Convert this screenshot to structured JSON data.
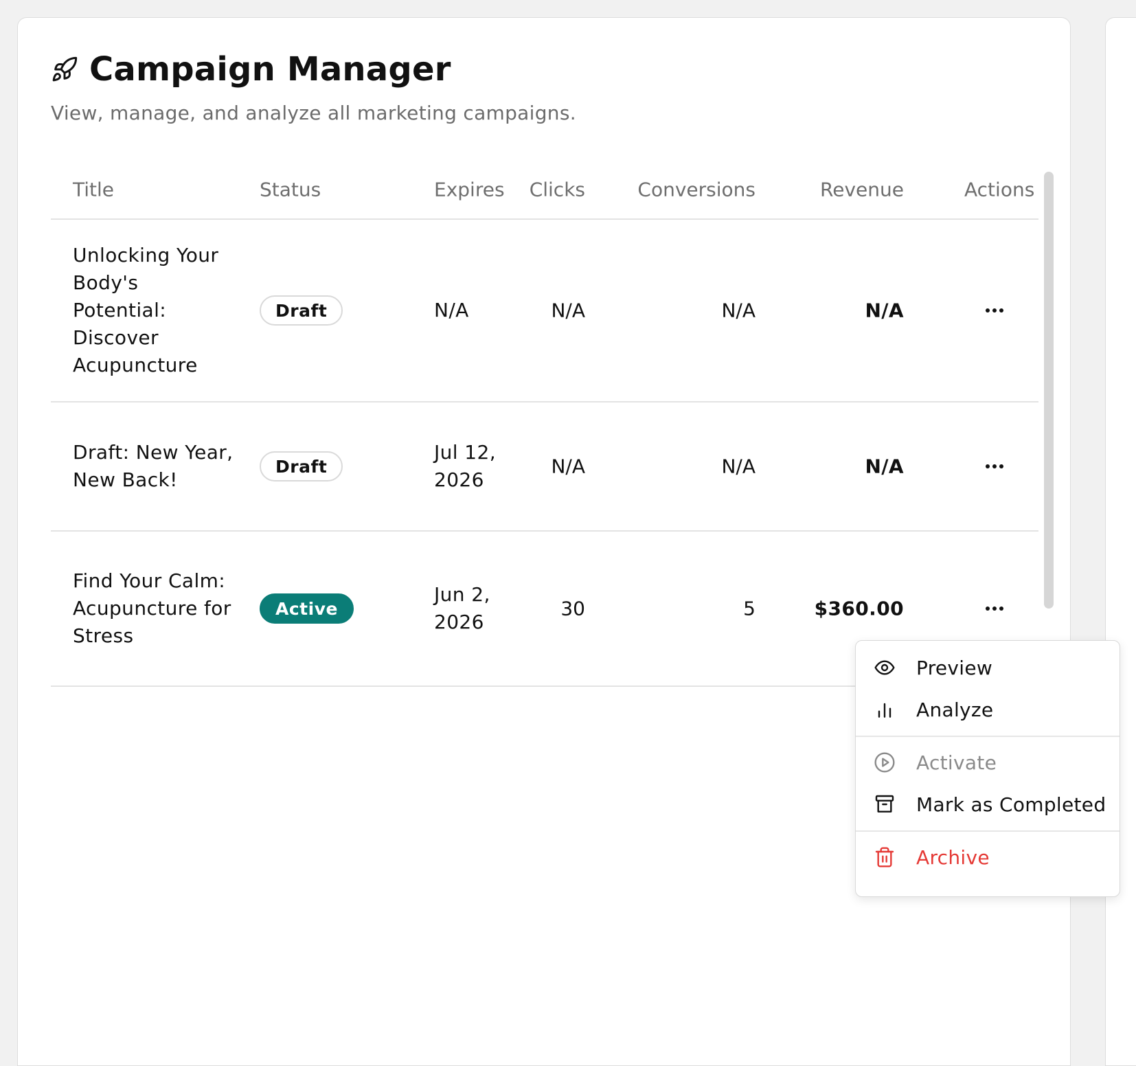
{
  "header": {
    "title": "Campaign Manager",
    "subtitle": "View, manage, and analyze all marketing campaigns.",
    "icon": "rocket-icon"
  },
  "table": {
    "columns": [
      "Title",
      "Status",
      "Expires",
      "Clicks",
      "Conversions",
      "Revenue",
      "Actions"
    ],
    "rows": [
      {
        "title": "Unlocking Your Body's Potential: Discover Acupuncture",
        "status": "Draft",
        "expires": "N/A",
        "clicks": "N/A",
        "conversions": "N/A",
        "revenue": "N/A"
      },
      {
        "title": "Draft: New Year, New Back!",
        "status": "Draft",
        "expires": "Jul 12, 2026",
        "clicks": "N/A",
        "conversions": "N/A",
        "revenue": "N/A"
      },
      {
        "title": "Find Your Calm: Acupuncture for Stress",
        "status": "Active",
        "expires": "Jun 2, 2026",
        "clicks": "30",
        "conversions": "5",
        "revenue": "$360.00"
      }
    ]
  },
  "menu": {
    "items": [
      {
        "label": "Preview",
        "icon": "eye-icon"
      },
      {
        "label": "Analyze",
        "icon": "bar-chart-icon"
      },
      {
        "label": "Activate",
        "icon": "play-circle-icon",
        "disabled": true
      },
      {
        "label": "Mark as Completed",
        "icon": "archive-box-icon"
      },
      {
        "label": "Archive",
        "icon": "trash-icon",
        "danger": true
      }
    ]
  },
  "colors": {
    "active_badge": "#0b7d77",
    "danger": "#e53935",
    "muted_text": "#6e6e6e"
  }
}
